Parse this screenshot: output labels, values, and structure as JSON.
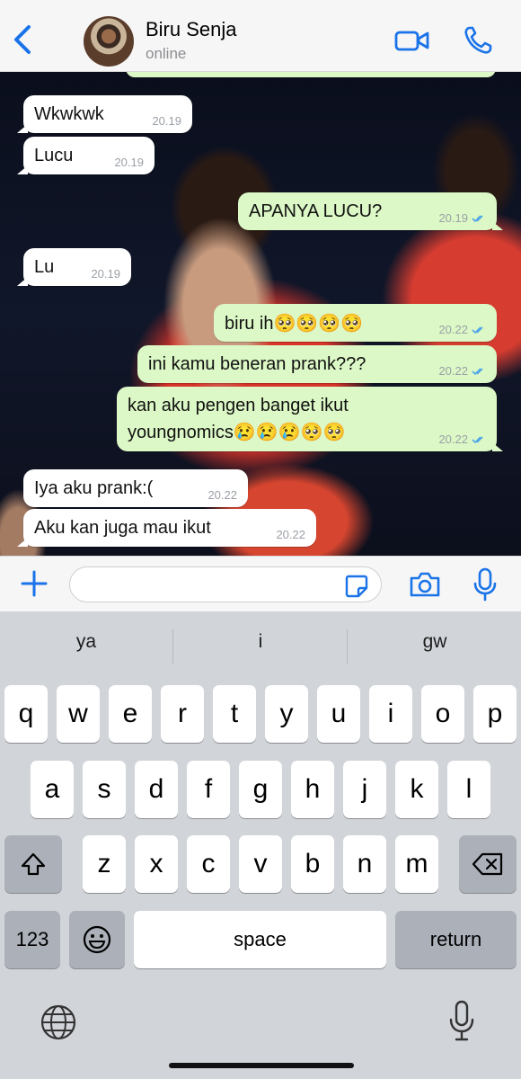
{
  "header": {
    "contact_name": "Biru Senja",
    "status": "online",
    "icons": {
      "back": "chevron-left-icon",
      "video": "video-camera-icon",
      "phone": "phone-icon"
    },
    "accent_color": "#1a73e8"
  },
  "messages": [
    {
      "dir": "in",
      "text": "Wkwkwk",
      "time": "20.19"
    },
    {
      "dir": "in",
      "text": "Lucu",
      "time": "20.19"
    },
    {
      "dir": "out",
      "text": "APANYA LUCU?",
      "time": "20.19",
      "read": true
    },
    {
      "dir": "in",
      "text": "Lu",
      "time": "20.19"
    },
    {
      "dir": "out",
      "text": "biru ih🥺🥺🥺🥺",
      "time": "20.22",
      "read": true
    },
    {
      "dir": "out",
      "text": "ini kamu beneran prank???",
      "time": "20.22",
      "read": true
    },
    {
      "dir": "out",
      "line1": "kan aku pengen banget ikut",
      "line2": "youngnomics😢😢😢🥺🥺",
      "time": "20.22",
      "read": true
    },
    {
      "dir": "in",
      "text": "Iya aku prank:(",
      "time": "20.22"
    },
    {
      "dir": "in",
      "text": "Aku kan juga mau ikut",
      "time": "20.22"
    }
  ],
  "input": {
    "placeholder": "",
    "value": ""
  },
  "keyboard": {
    "suggestions": [
      "ya",
      "i",
      "gw"
    ],
    "row1": [
      "q",
      "w",
      "e",
      "r",
      "t",
      "y",
      "u",
      "i",
      "o",
      "p"
    ],
    "row2": [
      "a",
      "s",
      "d",
      "f",
      "g",
      "h",
      "j",
      "k",
      "l"
    ],
    "row3": [
      "z",
      "x",
      "c",
      "v",
      "b",
      "n",
      "m"
    ],
    "numbers_label": "123",
    "space_label": "space",
    "return_label": "return",
    "emoji_icon": "emoji-icon",
    "shift_icon": "shift-icon",
    "delete_icon": "delete-icon"
  },
  "colors": {
    "outgoing_bubble": "#dcf8c6",
    "incoming_bubble": "#ffffff",
    "read_ticks": "#4fa6e8"
  }
}
